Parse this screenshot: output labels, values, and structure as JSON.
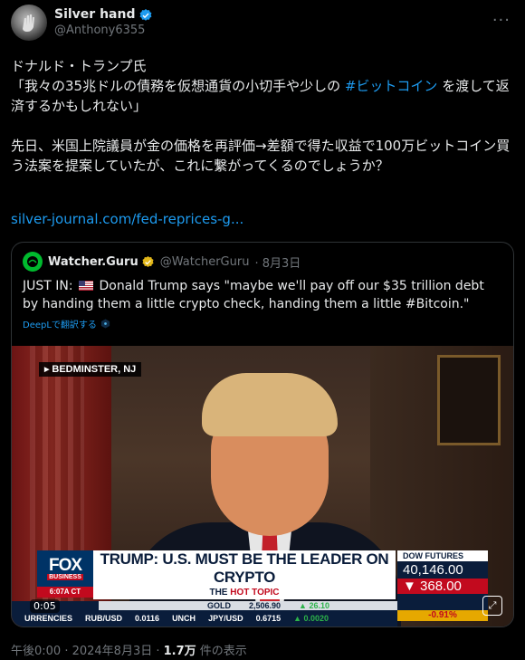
{
  "author": {
    "display_name": "Silver hand",
    "handle": "@Anthony6355"
  },
  "tweet": {
    "text_part1": "ドナルド・トランプ氏\n「我々の35兆ドルの債務を仮想通貨の小切手や少しの ",
    "hashtag": "#ビットコイン",
    "text_part2": " を渡して返済するかもしれない」\n\n先日、米国上院議員が金の価格を再評価→差額で得た収益で100万ビットコイン買う法案を提案していたが、これに繋がってくるのでしょうか？",
    "link": "silver-journal.com/fed-reprices-g..."
  },
  "quote": {
    "display_name": "Watcher.Guru",
    "handle": "@WatcherGuru",
    "date": "· 8月3日",
    "text_prefix": "JUST IN:",
    "text_body": " Donald Trump says \"maybe we'll pay off our $35 trillion debt by handing them a little crypto check, handing them a little #Bitcoin.\"",
    "translate_label": "DeepLで翻訳する"
  },
  "media": {
    "location": "BEDMINSTER, NJ",
    "network": "FOX",
    "network_sub": "BUSINESS",
    "headline": "TRUMP: U.S. MUST BE THE LEADER ON CRYPTO",
    "time": "6:07A CT",
    "topic_prefix": "THE",
    "topic_hot": "HOT TOPIC",
    "dow_label": "DOW FUTURES",
    "dow_value": "40,146.00",
    "dow_change": "▼ 368.00",
    "dow_pct": "-0.91%",
    "ticker_gold": "GOLD",
    "ticker_gold_val": "2,506.90",
    "ticker_gold_chg": "▲ 26.10",
    "ticker_currencies": "URRENCIES",
    "ticker_rub": "RUB/USD",
    "ticker_rub_val": "0.0116",
    "ticker_unch": "UNCH",
    "ticker_jpy": "JPY/USD",
    "ticker_jpy_val": "0.6715",
    "ticker_jpy_chg": "▲ 0.0020",
    "video_time": "0:05"
  },
  "footer": {
    "time": "午後0:00 · 2024年8月3日 · ",
    "views": "1.7万",
    "views_label": " 件の表示"
  },
  "colors": {
    "background": "#000000",
    "text": "#e7e9ea",
    "muted": "#71767b",
    "link": "#1d9bf0",
    "border": "#2f3336"
  }
}
